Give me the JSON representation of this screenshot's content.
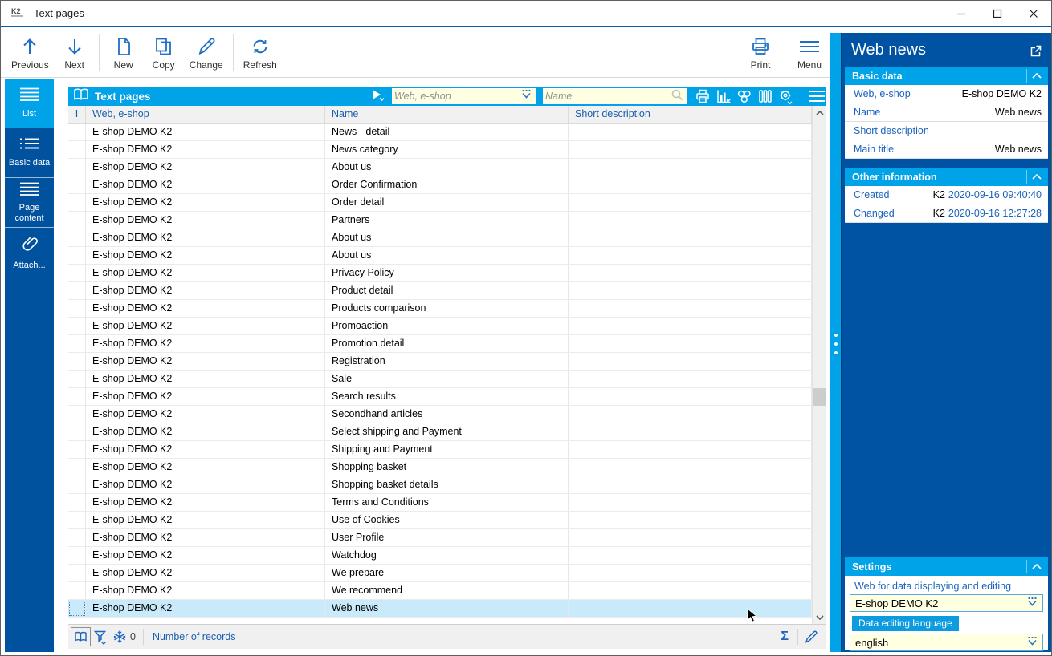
{
  "window": {
    "title": "Text pages",
    "controls": {
      "minimize": "minimize",
      "maximize": "maximize",
      "close": "close"
    }
  },
  "toolbar": {
    "buttons": [
      {
        "label": "Previous",
        "icon": "arrow-up-icon"
      },
      {
        "label": "Next",
        "icon": "arrow-down-icon"
      },
      {
        "label": "New",
        "icon": "new-document-icon"
      },
      {
        "label": "Copy",
        "icon": "copy-icon"
      },
      {
        "label": "Change",
        "icon": "pencil-icon"
      },
      {
        "label": "Refresh",
        "icon": "refresh-icon"
      },
      {
        "label": "Print",
        "icon": "printer-icon"
      },
      {
        "label": "Menu",
        "icon": "hamburger-icon"
      }
    ]
  },
  "sidebar": {
    "items": [
      {
        "label": "List",
        "icon": "list-icon",
        "active": true
      },
      {
        "label": "Basic data",
        "icon": "detail-list-icon",
        "active": false
      },
      {
        "label": "Page content",
        "icon": "content-lines-icon",
        "active": false
      },
      {
        "label": "Attach...",
        "icon": "paperclip-icon",
        "active": false
      }
    ]
  },
  "grid": {
    "title": "Text pages",
    "title_icon": "book-icon",
    "filters": [
      {
        "placeholder": "Web, e-shop",
        "icon": "dropdown-icon"
      },
      {
        "placeholder": "Name",
        "icon": "search-icon"
      }
    ],
    "header_icons": [
      "printer-icon",
      "chart-icon",
      "processes-icon",
      "columns-icon",
      "gear-icon",
      "hamburger-icon"
    ],
    "columns": [
      "I",
      "Web, e-shop",
      "Name",
      "Short description"
    ],
    "selected_index": 27,
    "rows": [
      {
        "web": "E-shop DEMO K2",
        "name": "News - detail",
        "desc": ""
      },
      {
        "web": "E-shop DEMO K2",
        "name": "News category",
        "desc": ""
      },
      {
        "web": "E-shop DEMO K2",
        "name": "About us",
        "desc": ""
      },
      {
        "web": "E-shop DEMO K2",
        "name": "Order Confirmation",
        "desc": ""
      },
      {
        "web": "E-shop DEMO K2",
        "name": "Order detail",
        "desc": ""
      },
      {
        "web": "E-shop DEMO K2",
        "name": "Partners",
        "desc": ""
      },
      {
        "web": "E-shop DEMO K2",
        "name": "About us",
        "desc": ""
      },
      {
        "web": "E-shop DEMO K2",
        "name": "About us",
        "desc": ""
      },
      {
        "web": "E-shop DEMO K2",
        "name": "Privacy Policy",
        "desc": ""
      },
      {
        "web": "E-shop DEMO K2",
        "name": "Product detail",
        "desc": ""
      },
      {
        "web": "E-shop DEMO K2",
        "name": "Products comparison",
        "desc": ""
      },
      {
        "web": "E-shop DEMO K2",
        "name": "Promoaction",
        "desc": ""
      },
      {
        "web": "E-shop DEMO K2",
        "name": "Promotion detail",
        "desc": ""
      },
      {
        "web": "E-shop DEMO K2",
        "name": "Registration",
        "desc": ""
      },
      {
        "web": "E-shop DEMO K2",
        "name": "Sale",
        "desc": ""
      },
      {
        "web": "E-shop DEMO K2",
        "name": "Search results",
        "desc": ""
      },
      {
        "web": "E-shop DEMO K2",
        "name": "Secondhand articles",
        "desc": ""
      },
      {
        "web": "E-shop DEMO K2",
        "name": "Select shipping and Payment",
        "desc": ""
      },
      {
        "web": "E-shop DEMO K2",
        "name": "Shipping and Payment",
        "desc": ""
      },
      {
        "web": "E-shop DEMO K2",
        "name": "Shopping basket",
        "desc": ""
      },
      {
        "web": "E-shop DEMO K2",
        "name": "Shopping basket details",
        "desc": ""
      },
      {
        "web": "E-shop DEMO K2",
        "name": "Terms and Conditions",
        "desc": ""
      },
      {
        "web": "E-shop DEMO K2",
        "name": "Use of Cookies",
        "desc": ""
      },
      {
        "web": "E-shop DEMO K2",
        "name": "User Profile",
        "desc": ""
      },
      {
        "web": "E-shop DEMO K2",
        "name": "Watchdog",
        "desc": ""
      },
      {
        "web": "E-shop DEMO K2",
        "name": "We prepare",
        "desc": ""
      },
      {
        "web": "E-shop DEMO K2",
        "name": "We recommend",
        "desc": ""
      },
      {
        "web": "E-shop DEMO K2",
        "name": "Web news",
        "desc": ""
      }
    ]
  },
  "status": {
    "icons": [
      "book-icon",
      "filter-funnel-icon",
      "snowflake-icon"
    ],
    "count": "0",
    "records_label": "Number of records",
    "right_icons": [
      "sigma-icon",
      "edit-pencil-icon"
    ],
    "sigma": "Σ"
  },
  "panel": {
    "title": "Web news",
    "export_icon": "open-in-window-icon",
    "sections": [
      {
        "title": "Basic data",
        "fields": [
          {
            "label": "Web, e-shop",
            "value": "E-shop DEMO K2"
          },
          {
            "label": "Name",
            "value": "Web news"
          },
          {
            "label": "Short description",
            "value": ""
          },
          {
            "label": "Main title",
            "value": "Web news"
          }
        ]
      },
      {
        "title": "Other information",
        "fields": [
          {
            "label": "Created",
            "prefix": "K2",
            "value": "2020-09-16 09:40:40"
          },
          {
            "label": "Changed",
            "prefix": "K2",
            "value": "2020-09-16 12:27:28"
          }
        ]
      },
      {
        "title": "Settings",
        "web_label": "Web for data displaying and editing",
        "web_value": "E-shop DEMO K2",
        "language_label": "Data editing language",
        "language_value": "english"
      }
    ]
  },
  "colors": {
    "accent": "#00A3E8",
    "sidebar_blue": "#00529F",
    "panel_blue": "#0053A3",
    "label_blue": "#1B63BE",
    "input_yellow": "#FFFFE1",
    "selected_row": "#C8EAFA"
  }
}
